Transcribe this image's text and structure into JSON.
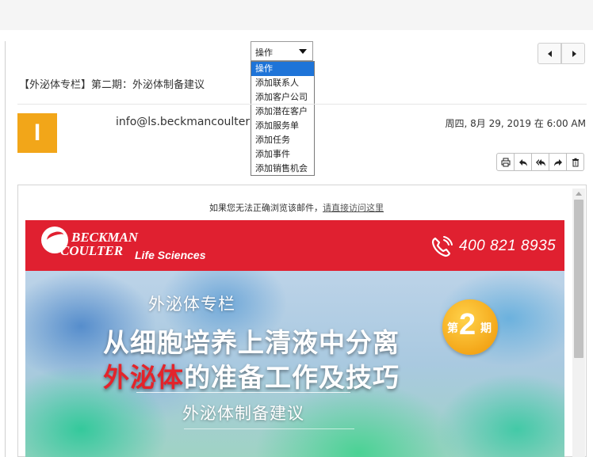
{
  "action_select": {
    "selected": "操作",
    "options": [
      "操作",
      "添加联系人",
      "添加客户公司",
      "添加潜在客户",
      "添加服务单",
      "添加任务",
      "添加事件",
      "添加销售机会"
    ]
  },
  "email": {
    "subject": "【外泌体专栏】第二期：外泌体制备建议",
    "avatar_letter": "I",
    "sender": "info@ls.beckmancoulter",
    "datetime": "周四, 8月 29, 2019 在 6:00 AM"
  },
  "icons": {
    "prev": "chevron-left-icon",
    "next": "chevron-right-icon",
    "toolbar": [
      "print-icon",
      "reply-icon",
      "reply-all-icon",
      "forward-icon",
      "trash-icon"
    ]
  },
  "body": {
    "notice_text": "如果您无法正确浏览该邮件，",
    "notice_link": "请直接访问这里",
    "brand_line1": "BECKMAN",
    "brand_line2": "COULTER",
    "brand_sub": "Life Sciences",
    "phone": "400 821 8935",
    "hero_title1": "外泌体专栏",
    "hero_title2": "从细胞培养上清液中分离",
    "hero_title3_red": "外泌体",
    "hero_title3_rest": "的准备工作及技巧",
    "hero_title4": "外泌体制备建议",
    "badge_pre": "第",
    "badge_num": "2",
    "badge_post": "期"
  },
  "colors": {
    "brand_red": "#e02030",
    "avatar": "#f2a619",
    "select_highlight": "#1e74d8",
    "badge": "#f3a416"
  }
}
